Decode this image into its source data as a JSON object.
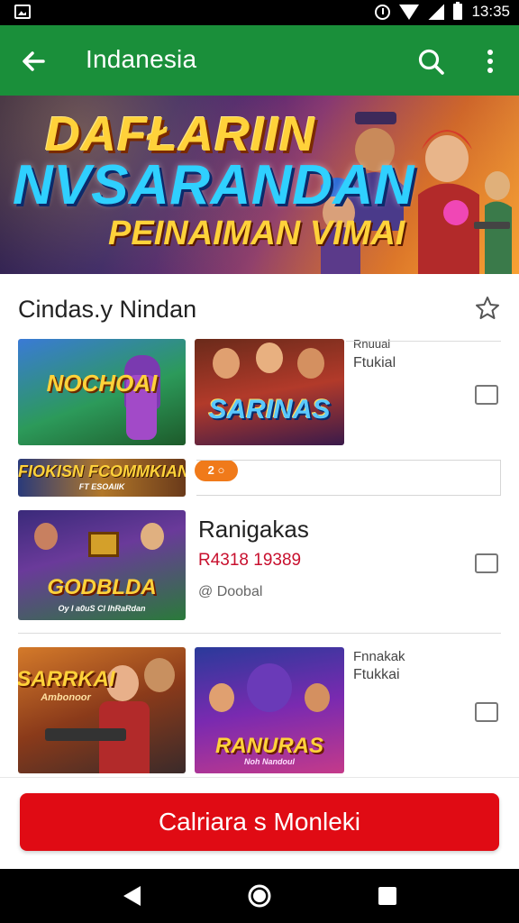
{
  "status_bar": {
    "time": "13:35",
    "icons": [
      "image-icon",
      "alarm-icon",
      "wifi-icon",
      "signal-icon",
      "battery-icon"
    ]
  },
  "app_bar": {
    "title": "Indanesia",
    "icons": [
      "back-arrow-icon",
      "search-icon",
      "more-vert-icon"
    ]
  },
  "banner": {
    "line1": "DAFŁARIIN",
    "line2": "NVSARANDAN",
    "line3": "PEINAIMAN VIMAI"
  },
  "section": {
    "title": "Cindas.y Nindan",
    "star_icon": "star-outline-icon"
  },
  "rows": [
    {
      "thumbs": [
        {
          "label": "NOCHOAI",
          "sub": ""
        },
        {
          "label": "SARINAS",
          "sub": ""
        }
      ],
      "side_line1": "Rnuual",
      "side_line2": "Ftukial"
    },
    {
      "strip_left": "FIOKISN FCOMMKIAN",
      "strip_sub": "FT ESOAIIK",
      "badge": "2 ○"
    },
    {
      "thumbs": [
        {
          "label": "GODBLDA",
          "sub": "Oy I a0uS Cl IhRaRdan"
        }
      ],
      "title": "Ranigakas",
      "price": "R4318 19389",
      "meta": "@ Doobal"
    },
    {
      "thumbs": [
        {
          "label": "SARRKAI",
          "sub": "Ambonoor"
        },
        {
          "label": "RANURAS",
          "sub": "Noh Nandoul"
        }
      ],
      "side_line1": "Fnnakak",
      "side_line2": "Ftukkai"
    }
  ],
  "cta": {
    "label": "Calriara s Monleki"
  },
  "nav_bar": {
    "icons": [
      "nav-back-icon",
      "nav-home-icon",
      "nav-recents-icon"
    ]
  },
  "colors": {
    "app_bar": "#1a8f3a",
    "cta": "#e00b14",
    "price": "#c8102e"
  }
}
